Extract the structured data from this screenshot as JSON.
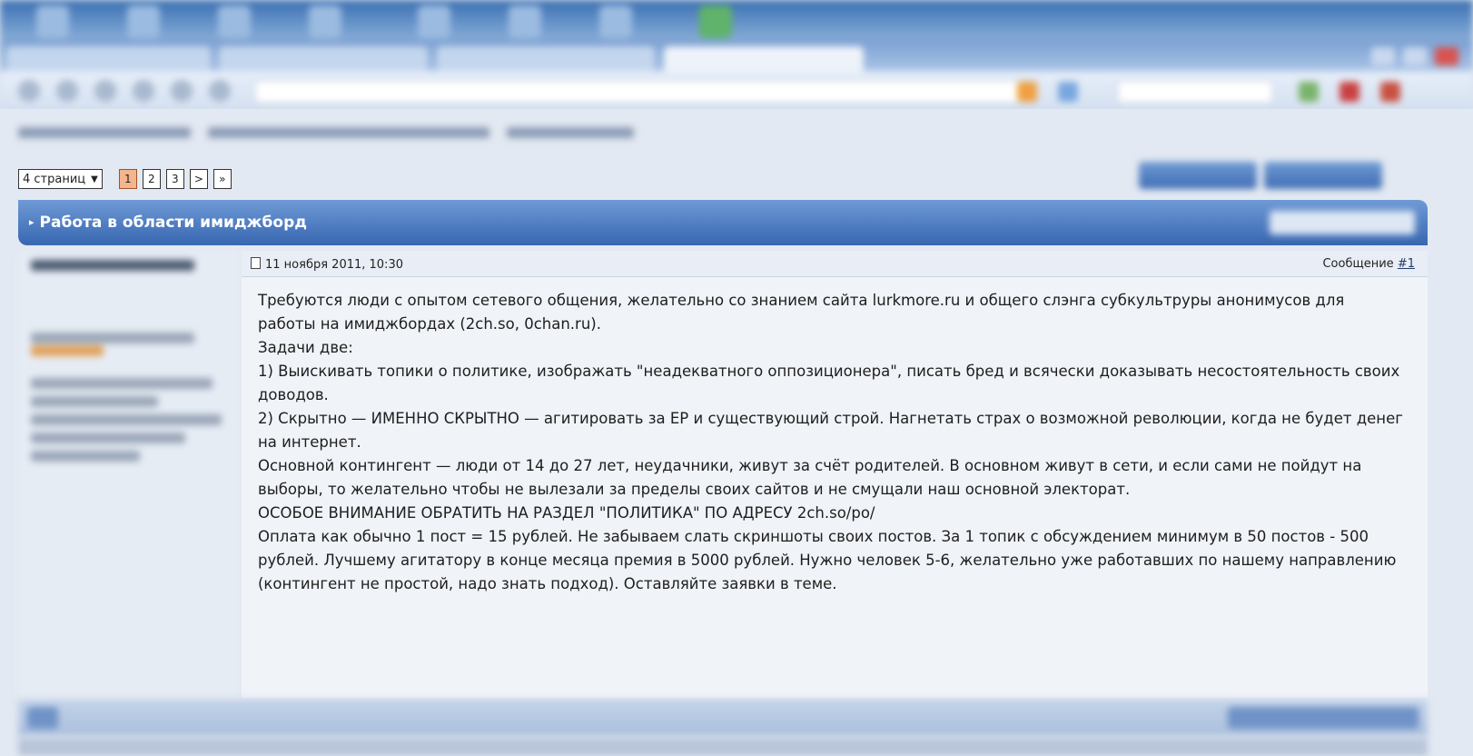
{
  "pagination": {
    "select_label": "4 страниц",
    "pages": [
      "1",
      "2",
      "3"
    ],
    "next": ">",
    "last": "»"
  },
  "thread": {
    "title": "Работа в области имиджборд"
  },
  "post": {
    "date": "11 ноября 2011, 10:30",
    "message_label": "Сообщение",
    "message_number": "#1",
    "body": [
      "Требуются люди с опытом сетевого общения, желательно со знанием сайта lurkmore.ru и общего слэнга субкультруры анонимусов для работы на имиджбордах (2ch.so, 0chan.ru).",
      "Задачи две:",
      "1) Выискивать топики о политике, изображать \"неадекватного оппозиционера\", писать бред и всячески доказывать несостоятельность своих доводов.",
      "2) Скрытно — ИМЕННО СКРЫТНО — агитировать за ЕР и существующий строй. Нагнетать страх о возможной революции, когда не будет денег на интернет.",
      "Основной контингент — люди от 14 до 27 лет, неудачники, живут за счёт родителей. В основном живут в сети, и если сами не пойдут на выборы, то желательно чтобы не вылезали за пределы своих сайтов и не смущали наш основной электорат.",
      "ОСОБОЕ ВНИМАНИЕ ОБРАТИТЬ НА РАЗДЕЛ \"ПОЛИТИКА\" ПО АДРЕСУ 2ch.so/po/",
      "Оплата как обычно 1 пост = 15 рублей. Не забываем слать скриншоты своих постов. За 1 топик с обсуждением минимум в 50 постов - 500 рублей. Лучшему агитатору в конце месяца премия в 5000 рублей. Нужно человек 5-6, желательно уже работавших по нашему направлению (контингент не простой, надо знать подход). Оставляйте заявки в теме."
    ]
  },
  "colors": {
    "thread_header": "#3766b0",
    "current_page": "#f5b58c"
  }
}
